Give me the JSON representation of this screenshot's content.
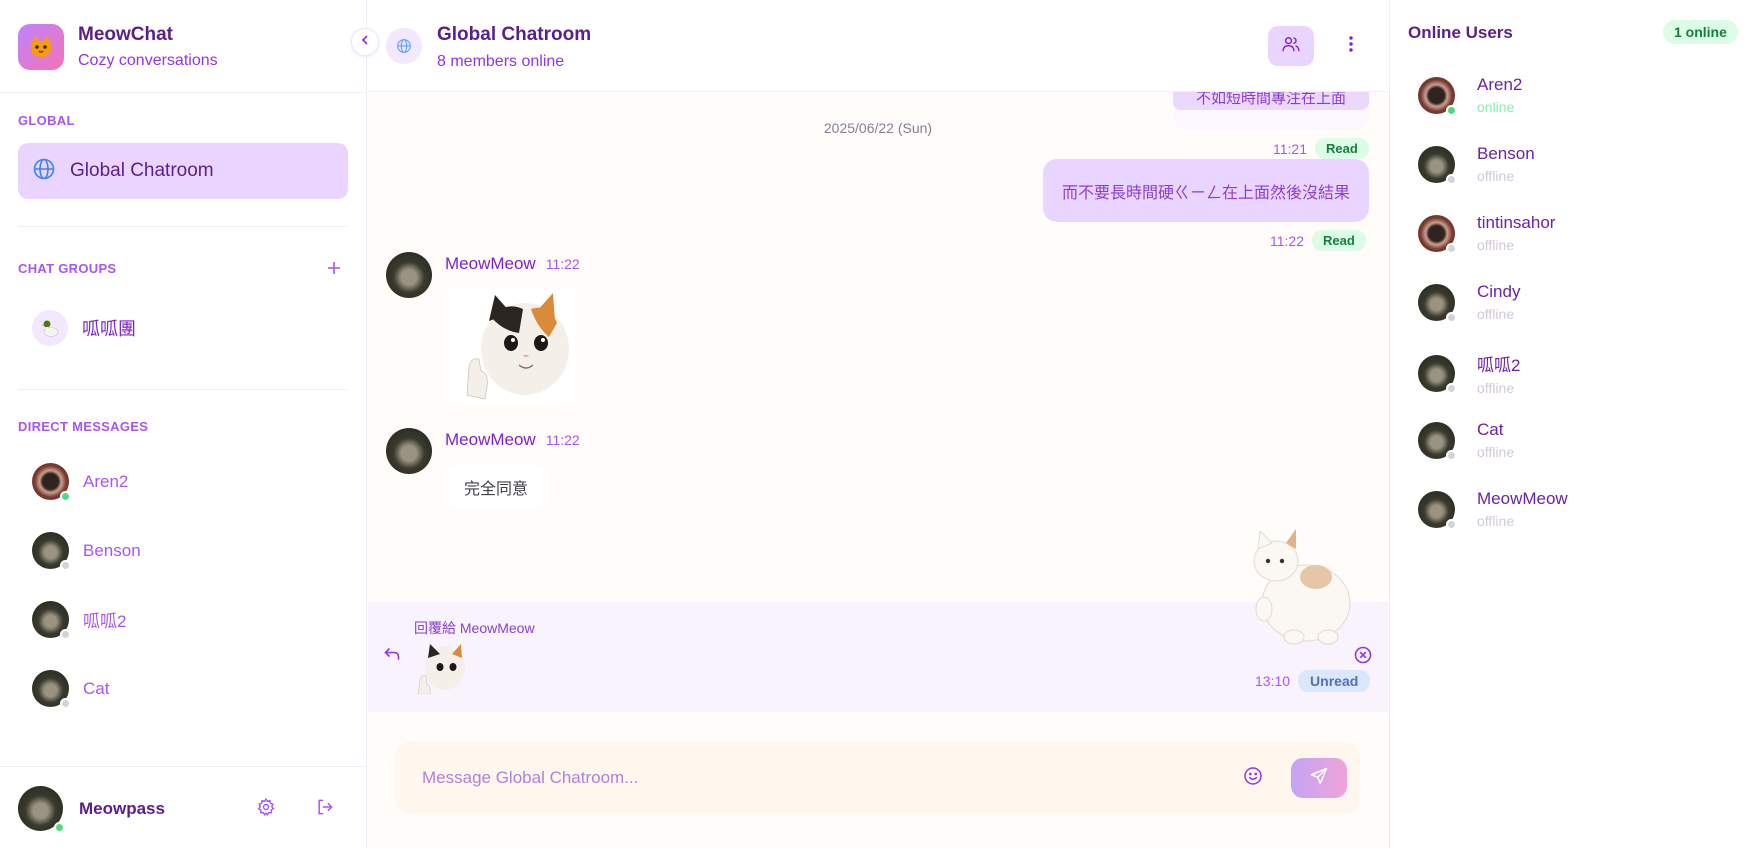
{
  "app": {
    "name": "MeowChat",
    "tagline": "Cozy conversations"
  },
  "sidebar": {
    "global_section": "GLOBAL",
    "global_item": "Global Chatroom",
    "groups_section": "CHAT GROUPS",
    "groups": [
      {
        "label": "呱呱團",
        "icon": "duck"
      }
    ],
    "dm_section": "DIRECT MESSAGES",
    "dms": [
      {
        "label": "Aren2",
        "online": true,
        "avatar": "bowl"
      },
      {
        "label": "Benson",
        "online": false,
        "avatar": "cat"
      },
      {
        "label": "呱呱2",
        "online": false,
        "avatar": "cat"
      },
      {
        "label": "Cat",
        "online": false,
        "avatar": "cat"
      }
    ],
    "current_user": {
      "label": "Meowpass",
      "online": true
    }
  },
  "chat": {
    "title": "Global Chatroom",
    "subtitle": "8 members online",
    "messages": {
      "top_bubble": "不如短時間專注在上面",
      "top_time": "11:21",
      "top_status": "Read",
      "date_separator": "2025/06/22 (Sun)",
      "my_message": "而不要長時間硬ㄍㄧㄥ在上面然後沒結果",
      "my_time": "11:22",
      "my_status": "Read",
      "sticker_sender": "MeowMeow",
      "sticker_time": "11:22",
      "text_sender": "MeowMeow",
      "text_time": "11:22",
      "text_message": "完全同意"
    },
    "reply": {
      "label": "回覆給 MeowMeow",
      "time": "13:10",
      "status": "Unread"
    },
    "composer": {
      "placeholder": "Message Global Chatroom..."
    }
  },
  "online_panel": {
    "title": "Online Users",
    "count": "1 online",
    "users": [
      {
        "name": "Aren2",
        "status": "online",
        "online": true,
        "avatar": "bowl"
      },
      {
        "name": "Benson",
        "status": "offline",
        "online": false,
        "avatar": "cat"
      },
      {
        "name": "tintinsahor",
        "status": "offline",
        "online": false,
        "avatar": "bowl"
      },
      {
        "name": "Cindy",
        "status": "offline",
        "online": false,
        "avatar": "cat"
      },
      {
        "name": "呱呱2",
        "status": "offline",
        "online": false,
        "avatar": "cat"
      },
      {
        "name": "Cat",
        "status": "offline",
        "online": false,
        "avatar": "cat"
      },
      {
        "name": "MeowMeow",
        "status": "offline",
        "online": false,
        "avatar": "cat"
      }
    ]
  },
  "colors": {
    "accent": "#9333ea",
    "accent_light": "#e9d5ff",
    "online": "#4ade80",
    "read_badge": "#dcfce7",
    "unread_badge": "#dbe7fb"
  }
}
